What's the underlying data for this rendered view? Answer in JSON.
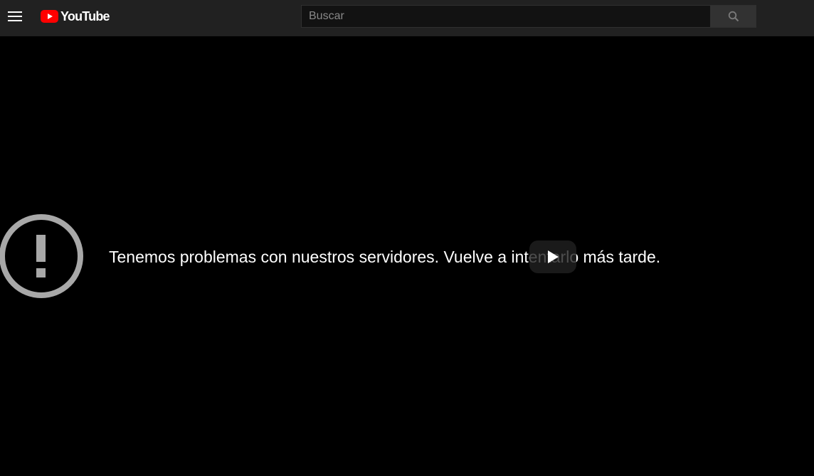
{
  "header": {
    "logo_text": "YouTube",
    "search": {
      "placeholder": "Buscar",
      "value": ""
    },
    "icons": {
      "menu": "hamburger-menu-icon",
      "logo": "youtube-logo-icon",
      "search": "search-icon"
    }
  },
  "player": {
    "error_message": "Tenemos problemas con nuestros servidores. Vuelve a intentarlo más tarde.",
    "icons": {
      "error": "error-exclamation-icon",
      "play": "play-icon"
    }
  },
  "colors": {
    "brand_red": "#ff0000",
    "topbar_bg": "#212121",
    "player_bg": "#000000",
    "error_icon": "#a8a8a8"
  }
}
